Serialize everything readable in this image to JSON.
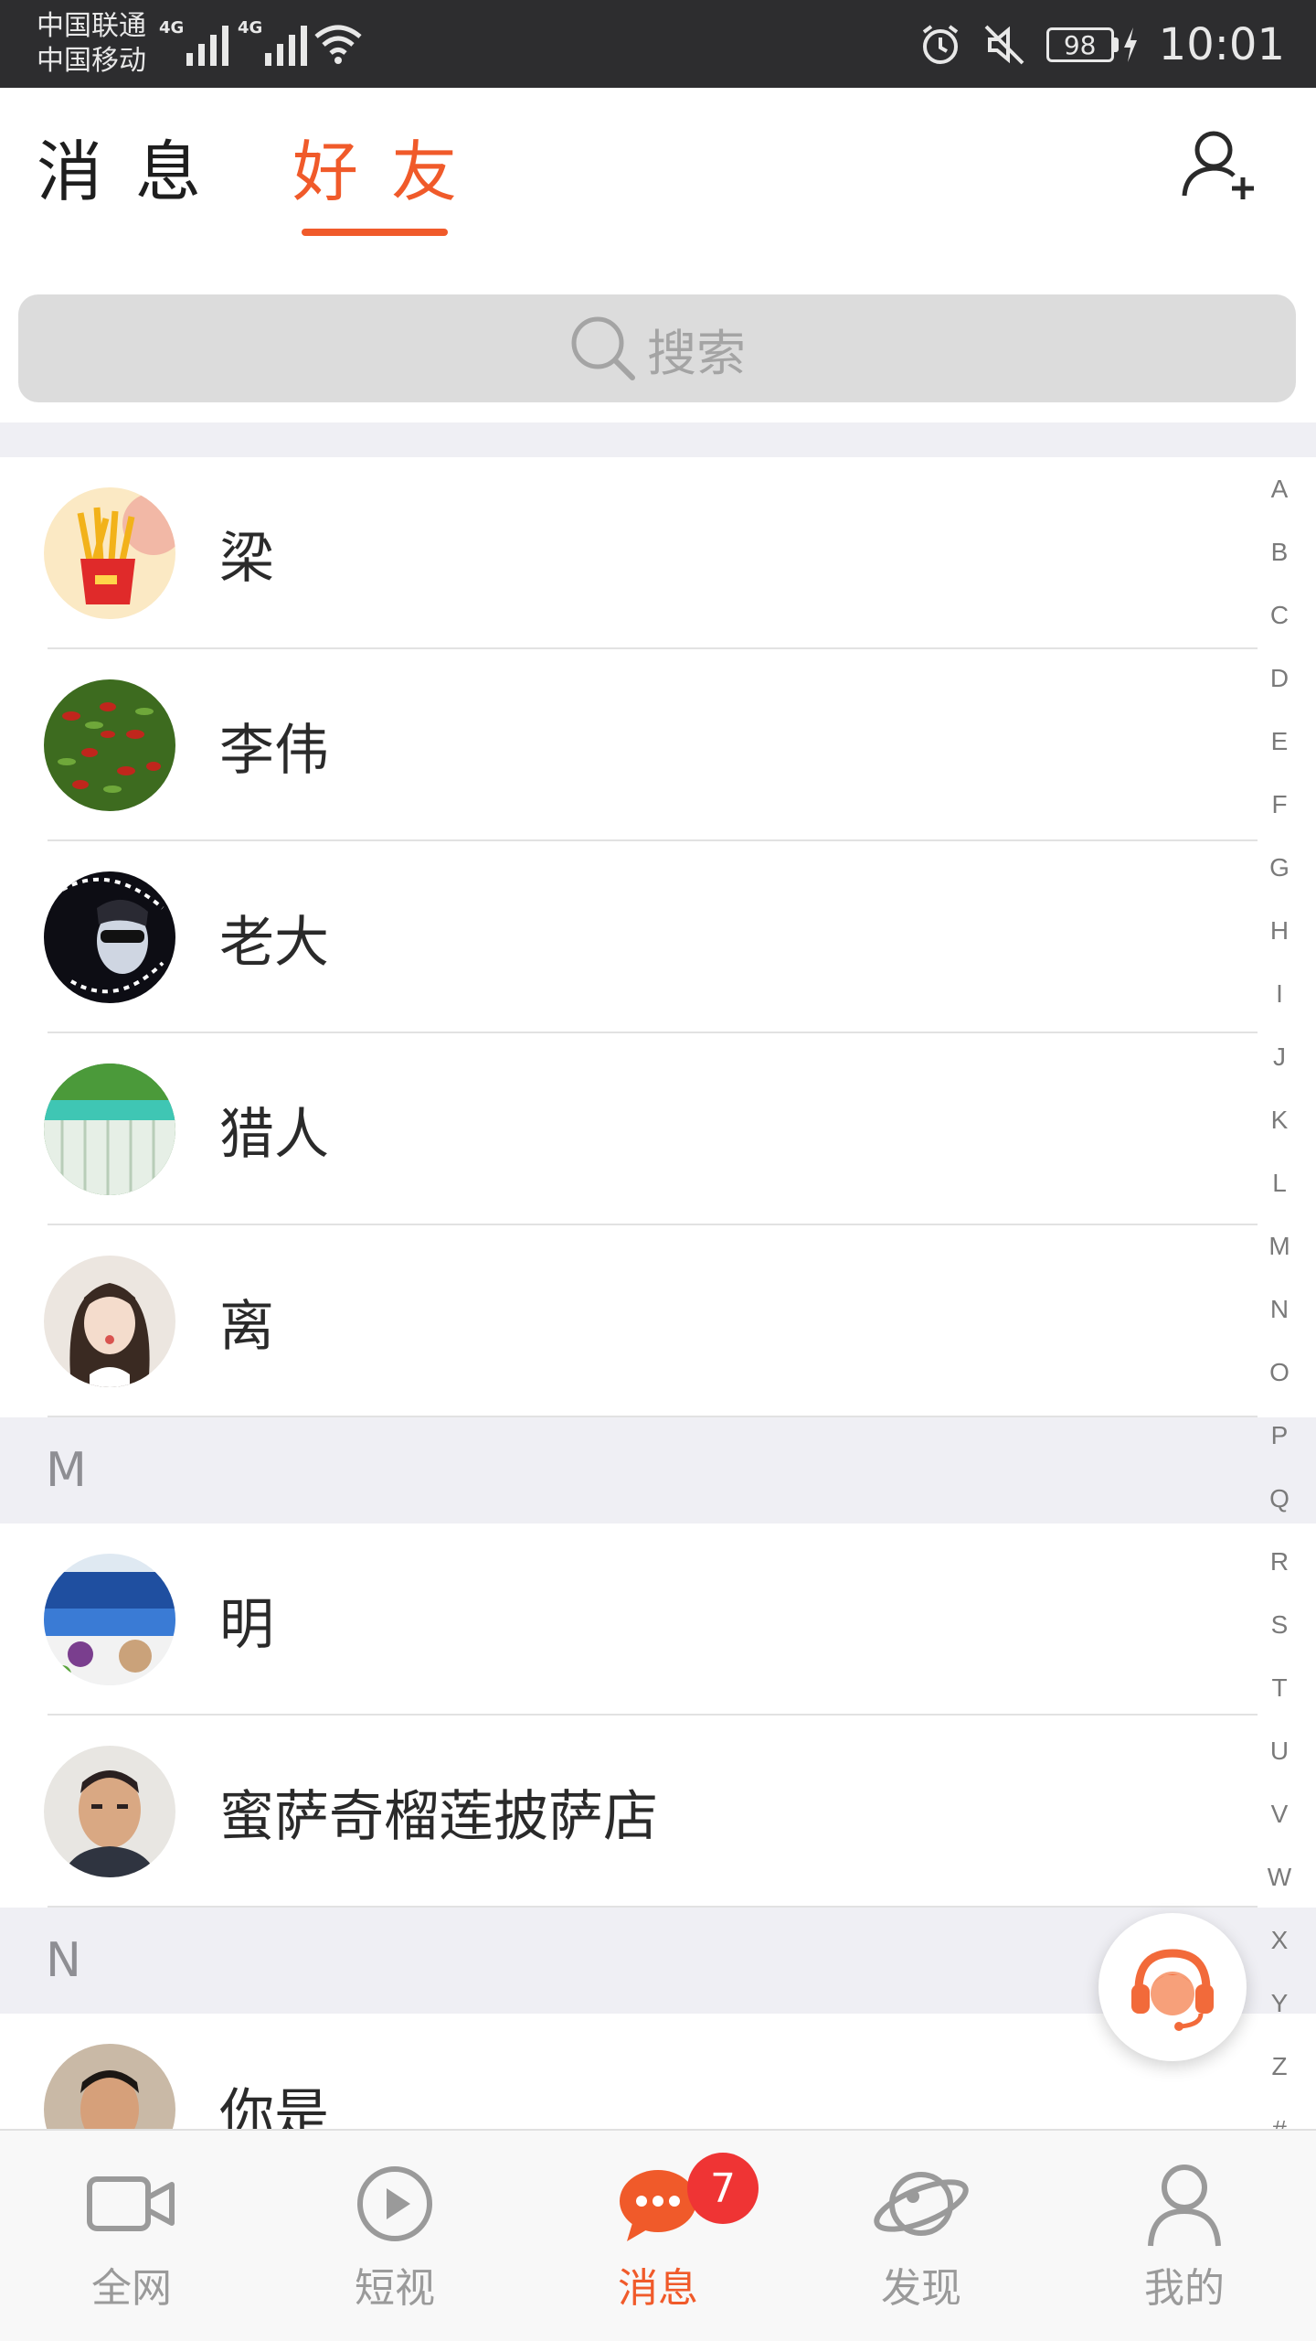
{
  "status_bar": {
    "carrier1": "中国联通",
    "carrier2": "中国移动",
    "net1": "4G",
    "net2": "4G",
    "battery": "98",
    "time": "10:01"
  },
  "header": {
    "tab_messages": "消息",
    "tab_friends": "好友",
    "active_tab": "tab_friends"
  },
  "search": {
    "placeholder": "搜索"
  },
  "sections": [
    {
      "letter": "",
      "contacts": [
        {
          "name": "梁",
          "avatar": "fries"
        },
        {
          "name": "李伟",
          "avatar": "peppers"
        },
        {
          "name": "老大",
          "avatar": "dark-portrait"
        },
        {
          "name": "猎人",
          "avatar": "waterfall"
        },
        {
          "name": "离",
          "avatar": "girl"
        }
      ]
    },
    {
      "letter": "M",
      "contacts": [
        {
          "name": "明",
          "avatar": "blueberry-drink"
        },
        {
          "name": "蜜萨奇榴莲披萨店",
          "avatar": "man"
        }
      ]
    },
    {
      "letter": "N",
      "contacts": [
        {
          "name": "你是",
          "avatar": "man2"
        }
      ]
    }
  ],
  "index_letters": [
    "A",
    "B",
    "C",
    "D",
    "E",
    "F",
    "G",
    "H",
    "I",
    "J",
    "K",
    "L",
    "M",
    "N",
    "O",
    "P",
    "Q",
    "R",
    "S",
    "T",
    "U",
    "V",
    "W",
    "X",
    "Y",
    "Z",
    "#"
  ],
  "bottom_nav": [
    {
      "label": "全网",
      "icon": "video-camera-icon"
    },
    {
      "label": "短视",
      "icon": "play-circle-icon"
    },
    {
      "label": "消息",
      "icon": "chat-bubble-icon",
      "active": true,
      "badge": "7"
    },
    {
      "label": "发现",
      "icon": "planet-icon"
    },
    {
      "label": "我的",
      "icon": "person-icon"
    }
  ],
  "colors": {
    "accent": "#f05a2a",
    "status_bar": "#2d2d2f",
    "section_bg": "#efeff4",
    "badge": "#ef3434"
  }
}
